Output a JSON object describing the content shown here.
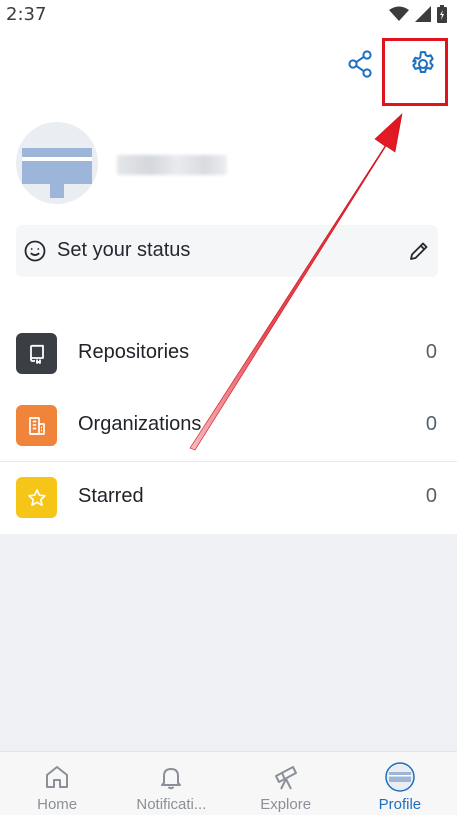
{
  "status_bar": {
    "time": "2:37",
    "icons": [
      "wifi-icon",
      "signal-icon",
      "battery-icon"
    ]
  },
  "topbar": {
    "icons": [
      "share-icon",
      "settings-icon"
    ]
  },
  "profile": {
    "status_placeholder": "Set your status"
  },
  "menu": [
    {
      "label": "Repositories",
      "count": "0",
      "icon": "repo-icon",
      "color": "#3b3f45"
    },
    {
      "label": "Organizations",
      "count": "0",
      "icon": "building-icon",
      "color": "#f0843a"
    },
    {
      "label": "Starred",
      "count": "0",
      "icon": "star-icon",
      "color": "#f5c518"
    }
  ],
  "bottom_nav": [
    {
      "label": "Home",
      "icon": "home-icon"
    },
    {
      "label": "Notificati...",
      "icon": "bell-icon"
    },
    {
      "label": "Explore",
      "icon": "telescope-icon"
    },
    {
      "label": "Profile",
      "icon": "avatar-icon",
      "active": true
    }
  ],
  "colors": {
    "accent": "#1f6fbf",
    "highlight": "#e0141e",
    "annotation_arrow": "#e0141e"
  }
}
